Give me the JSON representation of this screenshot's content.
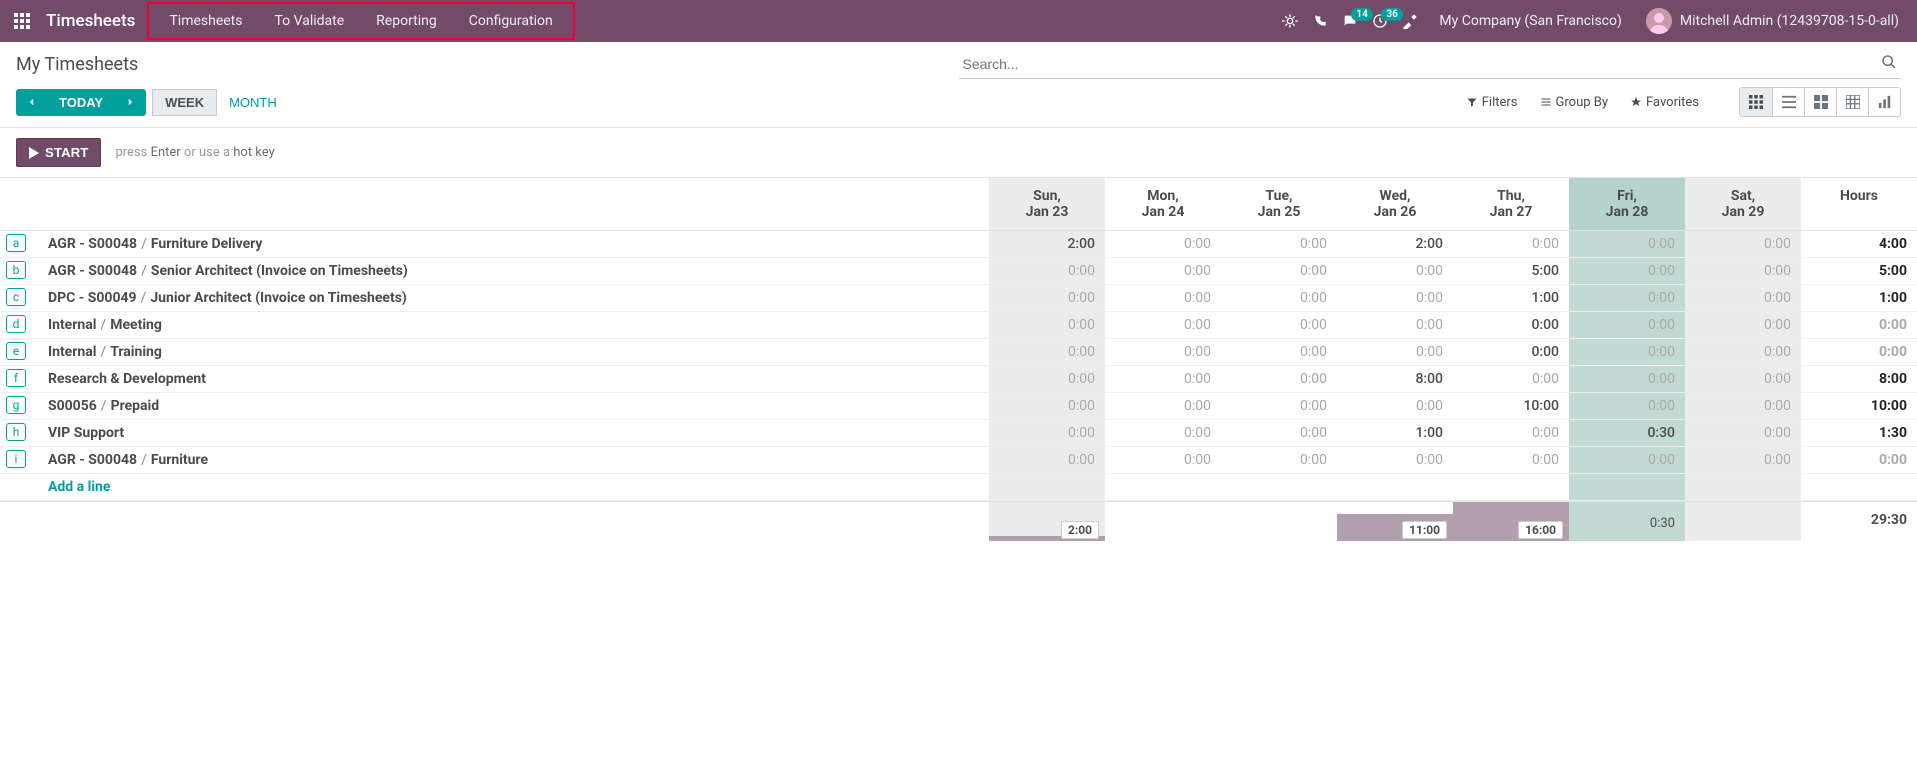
{
  "nav": {
    "brand": "Timesheets",
    "menu": [
      "Timesheets",
      "To Validate",
      "Reporting",
      "Configuration"
    ],
    "msg_count": "14",
    "activity_count": "36",
    "company": "My Company (San Francisco)",
    "user": "Mitchell Admin (12439708-15-0-all)"
  },
  "cp": {
    "title": "My Timesheets",
    "search_placeholder": "Search...",
    "today": "TODAY",
    "scale_week": "WEEK",
    "scale_month": "MONTH",
    "filters": "Filters",
    "groupby": "Group By",
    "favorites": "Favorites"
  },
  "start": {
    "button": "START",
    "hint_pre": "press ",
    "hint_key": "Enter",
    "hint_mid": " or use a ",
    "hint_hot": "hot key"
  },
  "days": [
    {
      "dow": "Sun,",
      "date": "Jan 23",
      "cls": "col-sun"
    },
    {
      "dow": "Mon,",
      "date": "Jan 24",
      "cls": ""
    },
    {
      "dow": "Tue,",
      "date": "Jan 25",
      "cls": ""
    },
    {
      "dow": "Wed,",
      "date": "Jan 26",
      "cls": ""
    },
    {
      "dow": "Thu,",
      "date": "Jan 27",
      "cls": ""
    },
    {
      "dow": "Fri,",
      "date": "Jan 28",
      "cls": "col-fri"
    },
    {
      "dow": "Sat,",
      "date": "Jan 29",
      "cls": "col-sat"
    }
  ],
  "hours_label": "Hours",
  "rows": [
    {
      "key": "a",
      "p1": "AGR - S00048",
      "p2": "Furniture Delivery",
      "cells": [
        "2:00",
        "0:00",
        "0:00",
        "2:00",
        "0:00",
        "0:00",
        "0:00"
      ],
      "has": [
        1,
        0,
        0,
        1,
        0,
        0,
        0
      ],
      "total": "4:00",
      "thas": 1
    },
    {
      "key": "b",
      "p1": "AGR - S00048",
      "p2": "Senior Architect (Invoice on Timesheets)",
      "cells": [
        "0:00",
        "0:00",
        "0:00",
        "0:00",
        "5:00",
        "0:00",
        "0:00"
      ],
      "has": [
        0,
        0,
        0,
        0,
        1,
        0,
        0
      ],
      "total": "5:00",
      "thas": 1
    },
    {
      "key": "c",
      "p1": "DPC - S00049",
      "p2": "Junior Architect (Invoice on Timesheets)",
      "cells": [
        "0:00",
        "0:00",
        "0:00",
        "0:00",
        "1:00",
        "0:00",
        "0:00"
      ],
      "has": [
        0,
        0,
        0,
        0,
        1,
        0,
        0
      ],
      "total": "1:00",
      "thas": 1
    },
    {
      "key": "d",
      "p1": "Internal",
      "p2": "Meeting",
      "cells": [
        "0:00",
        "0:00",
        "0:00",
        "0:00",
        "0:00",
        "0:00",
        "0:00"
      ],
      "has": [
        0,
        0,
        0,
        0,
        1,
        0,
        0
      ],
      "total": "0:00",
      "thas": 0
    },
    {
      "key": "e",
      "p1": "Internal",
      "p2": "Training",
      "cells": [
        "0:00",
        "0:00",
        "0:00",
        "0:00",
        "0:00",
        "0:00",
        "0:00"
      ],
      "has": [
        0,
        0,
        0,
        0,
        1,
        0,
        0
      ],
      "total": "0:00",
      "thas": 0
    },
    {
      "key": "f",
      "p1": "Research & Development",
      "p2": "",
      "cells": [
        "0:00",
        "0:00",
        "0:00",
        "8:00",
        "0:00",
        "0:00",
        "0:00"
      ],
      "has": [
        0,
        0,
        0,
        1,
        0,
        0,
        0
      ],
      "total": "8:00",
      "thas": 1
    },
    {
      "key": "g",
      "p1": "S00056",
      "p2": "Prepaid",
      "cells": [
        "0:00",
        "0:00",
        "0:00",
        "0:00",
        "10:00",
        "0:00",
        "0:00"
      ],
      "has": [
        0,
        0,
        0,
        0,
        1,
        0,
        0
      ],
      "total": "10:00",
      "thas": 1
    },
    {
      "key": "h",
      "p1": "VIP Support",
      "p2": "",
      "cells": [
        "0:00",
        "0:00",
        "0:00",
        "1:00",
        "0:00",
        "0:30",
        "0:00"
      ],
      "has": [
        0,
        0,
        0,
        1,
        0,
        1,
        0
      ],
      "total": "1:30",
      "thas": 1
    },
    {
      "key": "i",
      "p1": "AGR - S00048",
      "p2": "Furniture",
      "cells": [
        "0:00",
        "0:00",
        "0:00",
        "0:00",
        "0:00",
        "0:00",
        "0:00"
      ],
      "has": [
        0,
        0,
        0,
        0,
        0,
        0,
        0
      ],
      "total": "0:00",
      "thas": 0
    }
  ],
  "addline": "Add a line",
  "footer": {
    "cells": [
      {
        "label": "2:00",
        "bar": 12,
        "boxed": true
      },
      {
        "label": "",
        "bar": 0,
        "boxed": false
      },
      {
        "label": "",
        "bar": 0,
        "boxed": false
      },
      {
        "label": "11:00",
        "bar": 68,
        "boxed": true
      },
      {
        "label": "16:00",
        "bar": 100,
        "boxed": true
      },
      {
        "label": "0:30",
        "bar": 0,
        "boxed": false
      },
      {
        "label": "",
        "bar": 0,
        "boxed": false
      }
    ],
    "grand": "29:30"
  }
}
